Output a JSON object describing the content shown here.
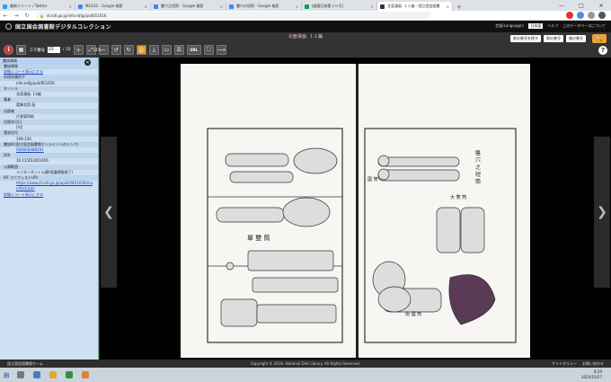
{
  "browser": {
    "tabs": [
      {
        "title": "最新ツイート / Twitter",
        "color": "#1da1f2"
      },
      {
        "title": "MG142 - Google 検索",
        "color": "#4285f4"
      },
      {
        "title": "雙穴之短筒 - Google 検索",
        "color": "#4285f4"
      },
      {
        "title": "雙穴の短筒 - Google 検索",
        "color": "#4285f4"
      },
      {
        "title": "[越國日録第３０号]",
        "color": "#0f9d58"
      },
      {
        "title": "北亜漫画. １１編 - 国立国会図書",
        "color": "#333333"
      }
    ],
    "active_tab": 5,
    "new_tab_symbol": "+",
    "window_controls": [
      "—",
      "□",
      "✕"
    ],
    "nav": {
      "back": "←",
      "forward": "→",
      "reload": "↻"
    },
    "url": "dl.ndl.go.jp/info:ndljp/pid/851656"
  },
  "site": {
    "title": "国立国会図書館デジタルコレクション",
    "language_label": "言語(Language):",
    "language_value": "日本語",
    "links": [
      "ヘルプ",
      "このデータベースについて"
    ]
  },
  "toolbar": {
    "book_title": "北亜漫画. １１編",
    "info": "i",
    "grid": "▦",
    "koma_label": "コマ番号",
    "koma_value": "25",
    "koma_total": "/ 33",
    "zoom_pct": "21%",
    "url_label": "URL",
    "prev_volume": "前の巻号を探す",
    "prev_issue": "前の巻号",
    "next_issue": "後の巻号",
    "help": "?"
  },
  "panel": {
    "header": "書誌情報",
    "close": "✕",
    "rows": [
      {
        "type": "label",
        "text": "書誌情報"
      },
      {
        "type": "link",
        "text": "詳細レコード表示にする"
      },
      {
        "type": "label",
        "text": "永続的識別子"
      },
      {
        "type": "value",
        "text": "info:ndljp/pid/851656"
      },
      {
        "type": "label",
        "text": "タイトル"
      },
      {
        "type": "value",
        "text": "北斎漫画. 11編"
      },
      {
        "type": "label",
        "text": "著者"
      },
      {
        "type": "value",
        "text": "葛飾北斎 画"
      },
      {
        "type": "label",
        "text": "出版者"
      },
      {
        "type": "value",
        "text": "片野東四郎"
      },
      {
        "type": "label",
        "text": "出版年月日"
      },
      {
        "type": "value",
        "text": "[刊]"
      },
      {
        "type": "label",
        "text": "請求記号"
      },
      {
        "type": "value",
        "text": "109-120"
      },
      {
        "type": "label",
        "text": "書誌ID(国立国会図書館オンラインへのリンク)"
      },
      {
        "type": "link-value",
        "text": "000000488591"
      },
      {
        "type": "label",
        "text": "DOI"
      },
      {
        "type": "value",
        "text": "10.11501/851656"
      },
      {
        "type": "label",
        "text": "公開範囲"
      },
      {
        "type": "value",
        "text": "インターネット公開(保護期間満了)"
      },
      {
        "type": "label",
        "text": "IIIF マニフェストURI"
      },
      {
        "type": "link-value",
        "text": "https://www.dl.ndl.go.jp/api/iiif/851656/ma"
      },
      {
        "type": "link-value",
        "text": "nifest.json"
      },
      {
        "type": "link",
        "text": "詳細レコード表示にする"
      }
    ]
  },
  "viewer": {
    "left_arrow": "❮",
    "right_arrow": "❯",
    "page_text": {
      "left_label": "單 雙 筒",
      "right_label": "雙 穴 之 短 筒",
      "right_label2": "大 雙 筒",
      "right_label3": "國 筒",
      "right_label4": "南 國 筒"
    }
  },
  "footer": {
    "home": "国立国会図書館ホーム",
    "copyright": "Copyright © 2016- National Diet Library. All Rights Reserved.",
    "links": [
      "サイトポリシー",
      "お問い合わせ"
    ]
  },
  "taskbar": {
    "start": "⊞",
    "time": "8:29",
    "date": "2020/10/27"
  }
}
